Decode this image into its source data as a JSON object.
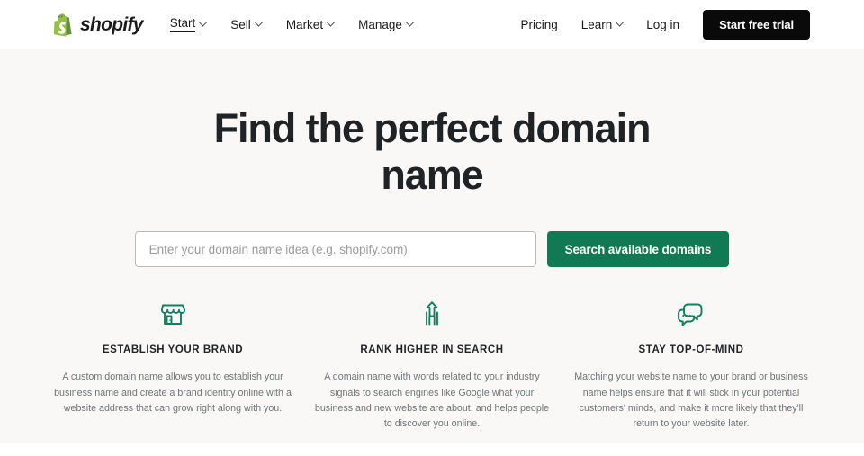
{
  "header": {
    "logo": {
      "icon": "shopify-bag-icon",
      "wordmark": "shopify",
      "brand_green": "#95BF47"
    },
    "nav_primary": [
      {
        "label": "Start",
        "icon": "chevron-down-icon",
        "active": true
      },
      {
        "label": "Sell",
        "icon": "chevron-down-icon",
        "active": false
      },
      {
        "label": "Market",
        "icon": "chevron-down-icon",
        "active": false
      },
      {
        "label": "Manage",
        "icon": "chevron-down-icon",
        "active": false
      }
    ],
    "nav_right": [
      {
        "label": "Pricing",
        "has_chevron": false
      },
      {
        "label": "Learn",
        "has_chevron": true
      },
      {
        "label": "Log in",
        "has_chevron": false
      }
    ],
    "cta": {
      "label": "Start free trial",
      "bg": "#0A0A0A",
      "color": "#FFFFFF"
    }
  },
  "hero": {
    "title": "Find the perfect domain name",
    "background": "#F9F8F6",
    "search": {
      "placeholder": "Enter your domain name idea (e.g. shopify.com)",
      "value": "",
      "button_label": "Search available domains",
      "button_bg": "#117A55"
    }
  },
  "features": [
    {
      "icon": "storefront-icon",
      "title": "ESTABLISH YOUR BRAND",
      "description": "A custom domain name allows you to establish your business name and create a brand identity online with a website address that can grow right along with you."
    },
    {
      "icon": "up-arrow-growth-icon",
      "title": "RANK HIGHER IN SEARCH",
      "description": "A domain name with words related to your industry signals to search engines like Google what your business and new website are about, and helps people to discover you online."
    },
    {
      "icon": "chat-bubbles-icon",
      "title": "STAY TOP-OF-MIND",
      "description": "Matching your website name to your brand or business name helps ensure that it will stick in your potential customers' minds, and make it more likely that they'll return to your website later."
    }
  ],
  "icon_color": "#108060"
}
